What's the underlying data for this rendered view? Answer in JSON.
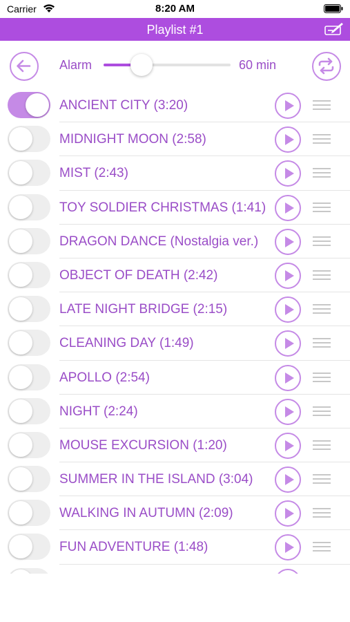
{
  "status_bar": {
    "carrier": "Carrier",
    "time": "8:20 AM"
  },
  "nav": {
    "title": "Playlist #1"
  },
  "controls": {
    "alarm_label": "Alarm",
    "alarm_value": "60 min",
    "alarm_slider_fraction": 0.3
  },
  "theme": {
    "accent": "#ad4ddf",
    "accent_light": "#c58ae6",
    "text": "#9a4dc7"
  },
  "icons": {
    "back": "arrow-left-icon",
    "repeat": "repeat-icon",
    "play": "play-icon",
    "drag": "drag-handle-icon",
    "edit": "edit-playlist-icon"
  },
  "tracks": [
    {
      "title": "ANCIENT CITY (3:20)",
      "enabled": true
    },
    {
      "title": "MIDNIGHT MOON (2:58)",
      "enabled": false
    },
    {
      "title": "MIST (2:43)",
      "enabled": false
    },
    {
      "title": "TOY SOLDIER CHRISTMAS (1:41)",
      "enabled": false
    },
    {
      "title": "DRAGON DANCE (Nostalgia ver.)",
      "enabled": false
    },
    {
      "title": "OBJECT OF DEATH (2:42)",
      "enabled": false
    },
    {
      "title": "LATE NIGHT BRIDGE (2:15)",
      "enabled": false
    },
    {
      "title": "CLEANING DAY (1:49)",
      "enabled": false
    },
    {
      "title": "APOLLO (2:54)",
      "enabled": false
    },
    {
      "title": "NIGHT (2:24)",
      "enabled": false
    },
    {
      "title": "MOUSE EXCURSION (1:20)",
      "enabled": false
    },
    {
      "title": "SUMMER IN THE ISLAND (3:04)",
      "enabled": false
    },
    {
      "title": "WALKING IN AUTUMN (2:09)",
      "enabled": false
    },
    {
      "title": "FUN ADVENTURE (1:48)",
      "enabled": false
    },
    {
      "title": "",
      "enabled": false
    }
  ]
}
